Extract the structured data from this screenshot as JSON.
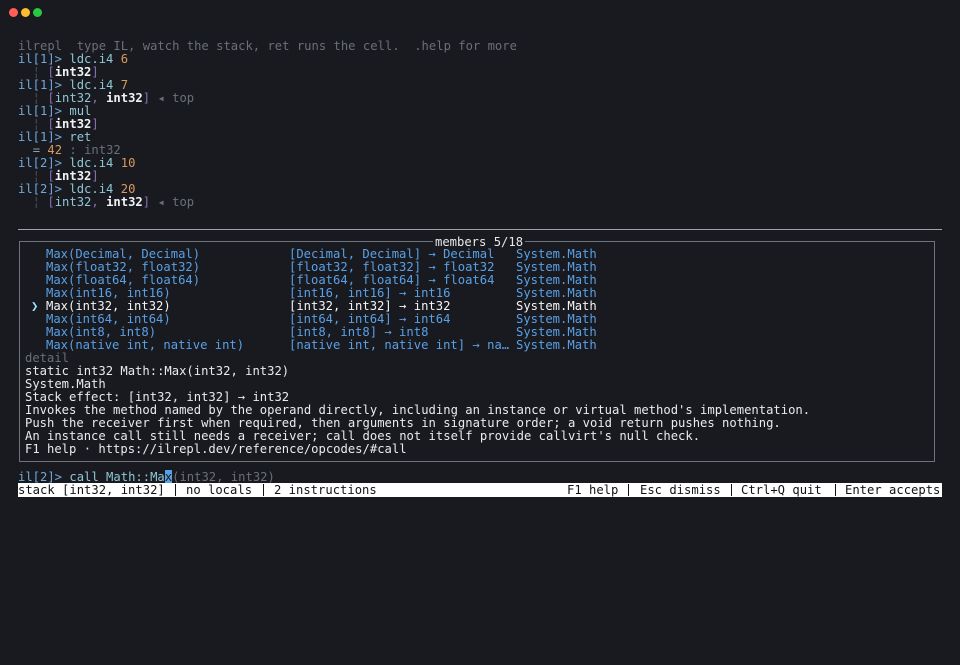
{
  "window": {
    "dots": [
      "#ff5f57",
      "#febc2e",
      "#28c840"
    ]
  },
  "banner": "ilrepl  type IL, watch the stack, ret runs the cell.  .help for more",
  "history": [
    {
      "prompt": "il[1]>",
      "op": "ldc.i4",
      "arg": "6",
      "stack_a": "int32",
      "stack_b": "",
      "top": ""
    },
    {
      "prompt": "il[1]>",
      "op": "ldc.i4",
      "arg": "7",
      "stack_a": "int32",
      "stack_b": "int32",
      "top": "◂ top"
    },
    {
      "prompt": "il[1]>",
      "op": "mul",
      "arg": "",
      "stack_a": "int32",
      "stack_b": "",
      "top": ""
    },
    {
      "prompt": "il[1]>",
      "op": "ret",
      "arg": "",
      "result_eq": "=",
      "result_val": "42",
      "result_type": ": int32"
    },
    {
      "prompt": "il[2]>",
      "op": "ldc.i4",
      "arg": "10",
      "stack_a": "int32",
      "stack_b": "",
      "top": ""
    },
    {
      "prompt": "il[2]>",
      "op": "ldc.i4",
      "arg": "20",
      "stack_a": "int32",
      "stack_b": "int32",
      "top": "◂ top"
    }
  ],
  "popup": {
    "title": "members 5/18",
    "members": [
      {
        "name": "Max(Decimal, Decimal)",
        "sig": "[Decimal, Decimal] → Decimal",
        "cls": "System.Math",
        "selected": false
      },
      {
        "name": "Max(float32, float32)",
        "sig": "[float32, float32] → float32",
        "cls": "System.Math",
        "selected": false
      },
      {
        "name": "Max(float64, float64)",
        "sig": "[float64, float64] → float64",
        "cls": "System.Math",
        "selected": false
      },
      {
        "name": "Max(int16, int16)",
        "sig": "[int16, int16] → int16",
        "cls": "System.Math",
        "selected": false
      },
      {
        "name": "Max(int32, int32)",
        "sig": "[int32, int32] → int32",
        "cls": "System.Math",
        "selected": true
      },
      {
        "name": "Max(int64, int64)",
        "sig": "[int64, int64] → int64",
        "cls": "System.Math",
        "selected": false
      },
      {
        "name": "Max(int8, int8)",
        "sig": "[int8, int8] → int8",
        "cls": "System.Math",
        "selected": false
      },
      {
        "name": "Max(native int, native int)",
        "sig": "[native int, native int] → na…",
        "cls": "System.Math",
        "selected": false
      }
    ],
    "selected_marker": "❯",
    "detail_label": "detail",
    "detail": [
      "static int32 Math::Max(int32, int32)",
      "System.Math",
      "Stack effect: [int32, int32] → int32",
      "Invokes the method named by the operand directly, including an instance or virtual method's implementation.",
      "Push the receiver first when required, then arguments in signature order; a void return pushes nothing.",
      "An instance call still needs a receiver; call does not itself provide callvirt's null check.",
      "F1 help · https://ilrepl.dev/reference/opcodes/#call"
    ]
  },
  "input": {
    "prompt": "il[2]>",
    "typed_before": "call Math::Ma",
    "cursor_char": "x",
    "ghost": "(int32, int32)"
  },
  "status": {
    "stack": "stack [int32, int32]",
    "locals": "no locals",
    "instructions": "2 instructions",
    "help": "F1 help",
    "dismiss": "Esc dismiss",
    "quit": "Ctrl+Q quit",
    "accept": "Enter accepts"
  }
}
